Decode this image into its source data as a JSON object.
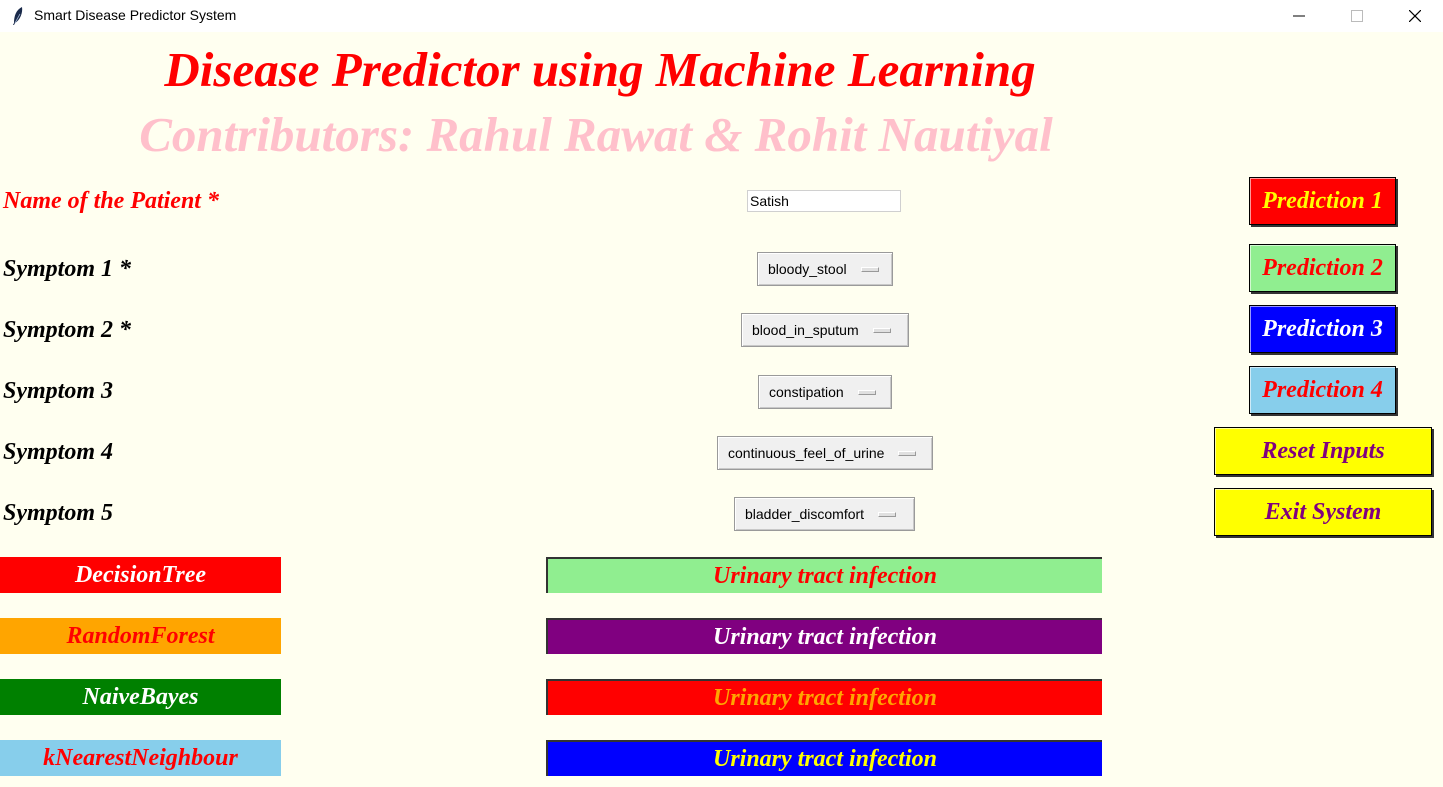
{
  "window": {
    "title": "Smart Disease Predictor System"
  },
  "header": {
    "title": "Disease Predictor using Machine Learning",
    "contributors": "Contributors: Rahul Rawat & Rohit Nautiyal"
  },
  "form": {
    "name_label": "Name of the Patient *",
    "name_value": "Satish",
    "symptoms": [
      {
        "label": "Symptom 1 *",
        "value": "bloody_stool"
      },
      {
        "label": "Symptom 2 *",
        "value": "blood_in_sputum"
      },
      {
        "label": "Symptom 3",
        "value": "constipation"
      },
      {
        "label": "Symptom 4",
        "value": "continuous_feel_of_urine"
      },
      {
        "label": "Symptom 5",
        "value": "bladder_discomfort"
      }
    ]
  },
  "buttons": {
    "prediction1": "Prediction 1",
    "prediction2": "Prediction 2",
    "prediction3": "Prediction 3",
    "prediction4": "Prediction 4",
    "reset": "Reset Inputs",
    "exit": "Exit System"
  },
  "results": [
    {
      "algorithm": "DecisionTree",
      "prediction": "Urinary tract infection"
    },
    {
      "algorithm": "RandomForest",
      "prediction": "Urinary tract infection"
    },
    {
      "algorithm": "NaiveBayes",
      "prediction": "Urinary tract infection"
    },
    {
      "algorithm": "kNearestNeighbour",
      "prediction": "Urinary tract infection"
    }
  ],
  "colors": {
    "background": "#fffff0",
    "title": "#ff0000",
    "contributors": "#ffc0cb",
    "prediction1_bg": "#ff0000",
    "prediction2_bg": "#90ee90",
    "prediction3_bg": "#0000ff",
    "prediction4_bg": "#87ceeb",
    "action_bg": "#ffff00",
    "action_text": "#800080"
  }
}
